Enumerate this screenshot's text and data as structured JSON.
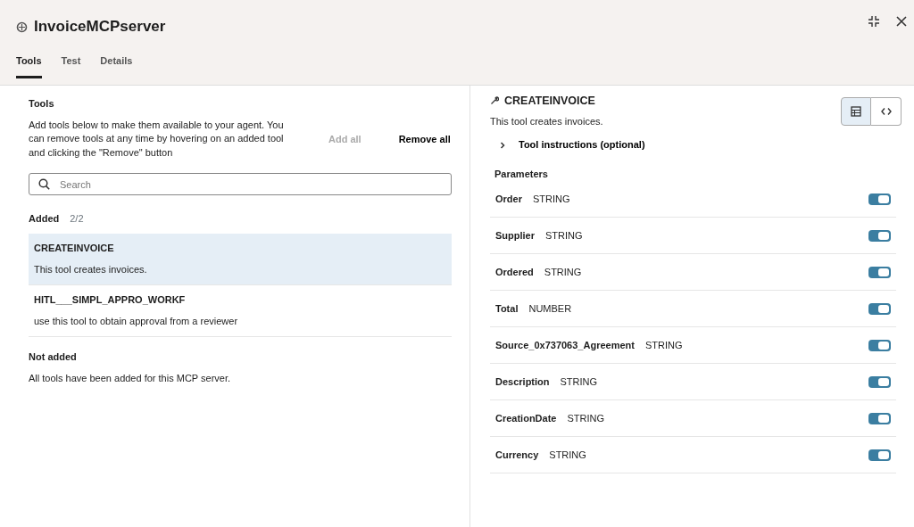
{
  "window": {
    "title": "InvoiceMCPserver"
  },
  "tabs": [
    {
      "label": "Tools",
      "selected": true
    },
    {
      "label": "Test",
      "selected": false
    },
    {
      "label": "Details",
      "selected": false
    }
  ],
  "tools_panel": {
    "heading": "Tools",
    "description": "Add tools below to make them available to your agent. You can remove tools at any time by hovering on an added tool and clicking the \"Remove\" button",
    "actions": [
      {
        "label": "Add all",
        "disabled": true
      },
      {
        "label": "Remove all",
        "disabled": false
      }
    ],
    "search": {
      "placeholder": "Search"
    },
    "added": {
      "heading": "Added",
      "count": "2/2",
      "items": [
        {
          "name": "CREATEINVOICE",
          "description": "This tool creates invoices.",
          "selected": true
        },
        {
          "name": "HITL___SIMPL_APPRO_WORKF",
          "description": "use this tool to obtain approval from a reviewer",
          "selected": false
        }
      ]
    },
    "not_added": {
      "heading": "Not added",
      "message": "All tools have been added for this MCP server."
    }
  },
  "detail": {
    "title": "CREATEINVOICE",
    "description": "This tool creates invoices.",
    "views": [
      {
        "kind": "table",
        "selected": true
      },
      {
        "kind": "code",
        "selected": false
      }
    ],
    "instructions": {
      "label": "Tool instructions (optional)",
      "expanded": false
    },
    "parameters_heading": "Parameters",
    "parameters": [
      {
        "name": "Order",
        "type": "STRING",
        "on": true
      },
      {
        "name": "Supplier",
        "type": "STRING",
        "on": true
      },
      {
        "name": "Ordered",
        "type": "STRING",
        "on": true
      },
      {
        "name": "Total",
        "type": "NUMBER",
        "on": true
      },
      {
        "name": "Source_0x737063_Agreement",
        "type": "STRING",
        "on": true
      },
      {
        "name": "Description",
        "type": "STRING",
        "on": true
      },
      {
        "name": "CreationDate",
        "type": "STRING",
        "on": true
      },
      {
        "name": "Currency",
        "type": "STRING",
        "on": true
      }
    ]
  }
}
